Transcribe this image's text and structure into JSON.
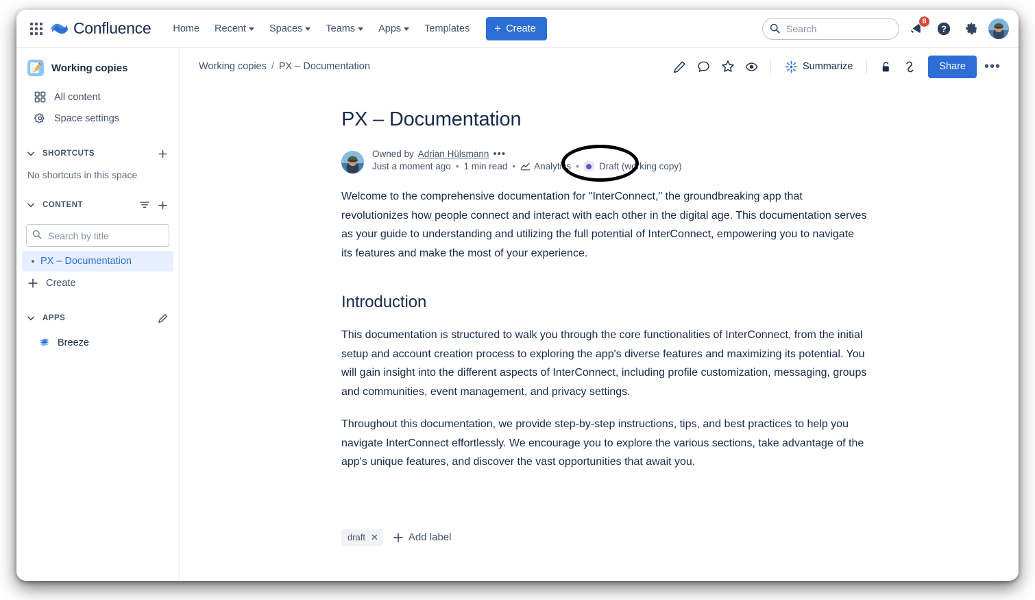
{
  "topnav": {
    "app_switcher_icon": "grid-apps-icon",
    "brand": "Confluence",
    "nav_items": [
      {
        "label": "Home",
        "has_caret": false
      },
      {
        "label": "Recent",
        "has_caret": true
      },
      {
        "label": "Spaces",
        "has_caret": true
      },
      {
        "label": "Teams",
        "has_caret": true
      },
      {
        "label": "Apps",
        "has_caret": true
      },
      {
        "label": "Templates",
        "has_caret": false
      }
    ],
    "create_label": "Create",
    "search_placeholder": "Search",
    "search_value": "",
    "notification_count": "8",
    "help_icon": "question-circle-icon",
    "settings_icon": "gear-icon",
    "avatar_icon": "user-avatar"
  },
  "sidebar": {
    "space_name": "Working copies",
    "space_icon": "clipboard-pencil-icon",
    "links": [
      {
        "label": "All content",
        "icon": "grid-squares-icon"
      },
      {
        "label": "Space settings",
        "icon": "gear-icon"
      }
    ],
    "shortcuts": {
      "label": "SHORTCUTS",
      "empty_text": "No shortcuts in this space",
      "add_icon": "plus-icon"
    },
    "content": {
      "label": "CONTENT",
      "filter_icon": "filter-icon",
      "add_icon": "plus-icon",
      "search_placeholder": "Search by title",
      "search_value": "",
      "pages": [
        {
          "label": "PX – Documentation",
          "selected": true
        }
      ],
      "create_label": "Create"
    },
    "apps": {
      "label": "APPS",
      "edit_icon": "pencil-icon",
      "items": [
        {
          "label": "Breeze",
          "icon": "breeze-waves-icon"
        }
      ]
    }
  },
  "toolbar": {
    "breadcrumb": {
      "space": "Working copies",
      "separator": "/",
      "current": "PX – Documentation"
    },
    "icons": [
      {
        "name": "edit-pencil-icon"
      },
      {
        "name": "comment-icon"
      },
      {
        "name": "star-icon"
      },
      {
        "name": "watch-eye-icon"
      }
    ],
    "summarize_label": "Summarize",
    "summarize_icon": "ai-sparkle-icon",
    "restrictions_icon": "lock-unlocked-icon",
    "copy_link_icon": "link-icon",
    "share_label": "Share",
    "more_label": "•••"
  },
  "page": {
    "title": "PX – Documentation",
    "byline": {
      "owned_by_prefix": "Owned by",
      "owner": "Adrian Hülsmann",
      "more_dots": "•••",
      "updated": "Just a moment ago",
      "read_time": "1 min read",
      "analytics_label": "Analytics",
      "analytics_icon": "analytics-chart-icon",
      "status_label": "Draft (working copy)",
      "separator": "•"
    },
    "paragraphs": [
      "Welcome to the comprehensive documentation for \"InterConnect,\" the groundbreaking app that revolutionizes how people connect and interact with each other in the digital age. This documentation serves as your guide to understanding and utilizing the full potential of InterConnect, empowering you to navigate its features and make the most of your experience."
    ],
    "section_heading": "Introduction",
    "section_paragraphs": [
      "This documentation is structured to walk you through the core functionalities of InterConnect, from the initial setup and account creation process to exploring the app's diverse features and maximizing its potential. You will gain insight into the different aspects of InterConnect, including profile customization, messaging, groups and communities, event management, and privacy settings.",
      "Throughout this documentation, we provide step-by-step instructions, tips, and best practices to help you navigate InterConnect effortlessly. We encourage you to explore the various sections, take advantage of the app's unique features, and discover the vast opportunities that await you."
    ],
    "labels": {
      "chips": [
        {
          "text": "draft",
          "remove": "✕"
        }
      ],
      "add_label": "Add label"
    }
  },
  "annotation": {
    "type": "ellipse-highlight",
    "target": "Draft (working copy)",
    "color": "#000000"
  },
  "colors": {
    "brand_blue": "#2c6ed5",
    "text_primary": "#172b4d",
    "text_secondary": "#42526e",
    "draft_purple": "#6554c0",
    "badge_red": "#d94a3d",
    "selected_row": "#e6efff"
  }
}
